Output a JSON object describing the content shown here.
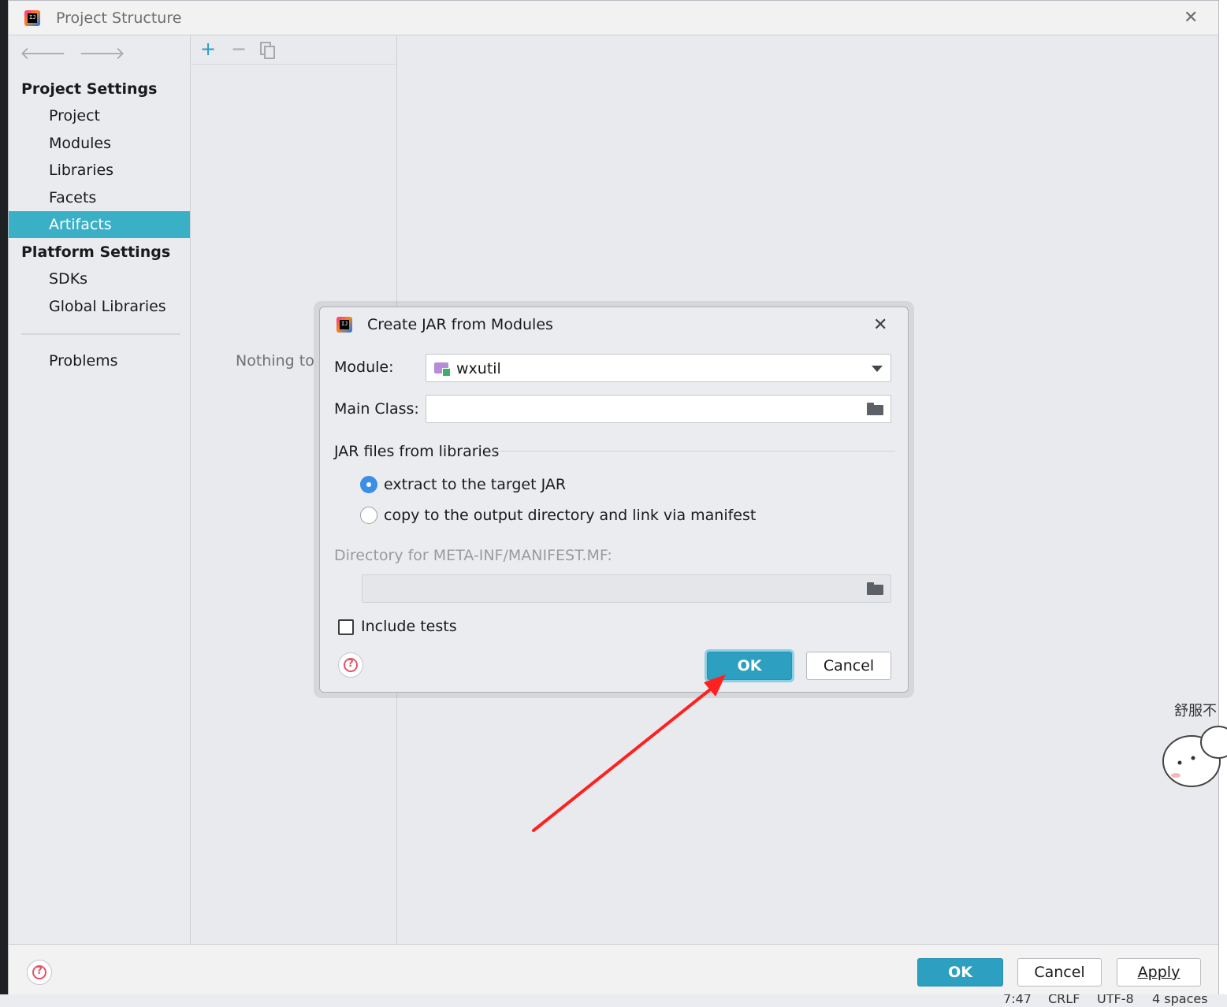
{
  "window": {
    "title": "Project Structure",
    "app_icon_text": "IJ"
  },
  "sidebar": {
    "project_settings_header": "Project Settings",
    "project_items": [
      "Project",
      "Modules",
      "Libraries",
      "Facets",
      "Artifacts"
    ],
    "selected_item": "Artifacts",
    "platform_settings_header": "Platform Settings",
    "platform_items": [
      "SDKs",
      "Global Libraries"
    ],
    "problems": "Problems"
  },
  "middle": {
    "toolbar": {
      "add": "+",
      "remove": "−"
    },
    "empty_text": "Nothing to s"
  },
  "footer": {
    "help": "?",
    "ok": "OK",
    "cancel": "Cancel",
    "apply": "Apply"
  },
  "dialog": {
    "title": "Create JAR from Modules",
    "module_label": "Module:",
    "module_value": "wxutil",
    "main_class_label": "Main Class:",
    "main_class_value": "",
    "jar_group_label": "JAR files from libraries",
    "option_extract": "extract to the target JAR",
    "option_copy": "copy to the output directory and link via manifest",
    "selected_option": "extract",
    "manifest_dir_label": "Directory for META-INF/MANIFEST.MF:",
    "manifest_dir_value": "",
    "include_tests": "Include tests",
    "include_tests_checked": false,
    "help": "?",
    "ok": "OK",
    "cancel": "Cancel"
  },
  "background": {
    "sticker_text": "舒服不",
    "status_items": [
      "7:47",
      "CRLF",
      "UTF-8",
      "4 spaces"
    ]
  },
  "colors": {
    "accent_selected": "#3ab0c6",
    "primary_button": "#2d9fc0",
    "annotation_arrow": "#ff2020"
  }
}
